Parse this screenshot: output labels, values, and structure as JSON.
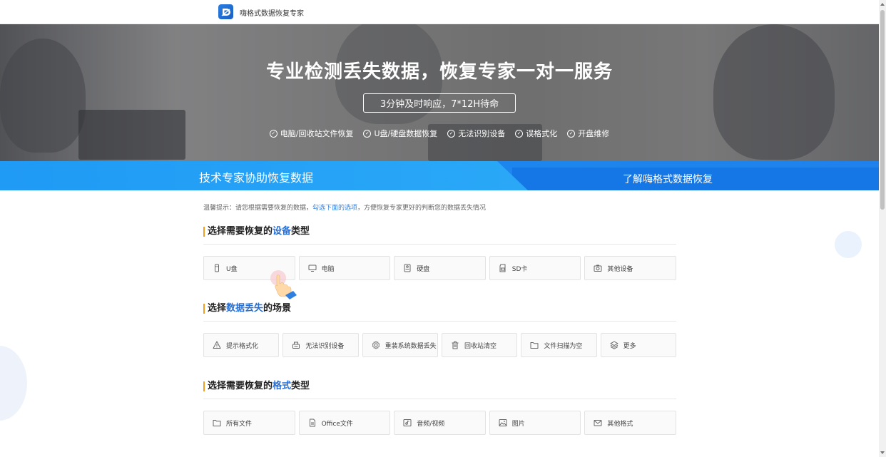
{
  "header": {
    "brand": "嗨格式数据恢复专家"
  },
  "hero": {
    "title": "专业检测丢失数据，恢复专家一对一服务",
    "subtitle": "3分钟及时响应，7*12H待命",
    "features": [
      "电脑/回收站文件恢复",
      "U盘/硬盘数据恢复",
      "无法识别设备",
      "误格式化",
      "开盘维修"
    ]
  },
  "banner": {
    "left": "技术专家协助恢复数据",
    "right": "了解嗨格式数据恢复"
  },
  "tip": {
    "prefix": "温馨提示：请您根据需要恢复的数据，",
    "highlight": "勾选下面的选项",
    "suffix": "，方便恢复专家更好的判断您的数据丢失情况"
  },
  "sections": [
    {
      "pre": "选择需要恢复的",
      "em": "设备",
      "post": "类型",
      "options": [
        {
          "label": "U盘",
          "icon": "usb-icon"
        },
        {
          "label": "电脑",
          "icon": "monitor-icon"
        },
        {
          "label": "硬盘",
          "icon": "harddisk-icon"
        },
        {
          "label": "SD卡",
          "icon": "sdcard-icon"
        },
        {
          "label": "其他设备",
          "icon": "camera-icon"
        }
      ]
    },
    {
      "pre": "选择",
      "em": "数据丢失",
      "post": "的场景",
      "options": [
        {
          "label": "提示格式化",
          "icon": "warning-icon"
        },
        {
          "label": "无法识别设备",
          "icon": "device-icon"
        },
        {
          "label": "重装系统数据丢失",
          "icon": "settings-icon"
        },
        {
          "label": "回收站清空",
          "icon": "trash-icon"
        },
        {
          "label": "文件扫描为空",
          "icon": "folder-icon"
        },
        {
          "label": "更多",
          "icon": "layers-icon"
        }
      ]
    },
    {
      "pre": "选择需要恢复的",
      "em": "格式",
      "post": "类型",
      "options": [
        {
          "label": "所有文件",
          "icon": "folder-icon"
        },
        {
          "label": "Office文件",
          "icon": "document-icon"
        },
        {
          "label": "音频/视频",
          "icon": "media-icon"
        },
        {
          "label": "图片",
          "icon": "image-icon"
        },
        {
          "label": "其他格式",
          "icon": "mail-icon"
        }
      ]
    }
  ],
  "colors": {
    "primary": "#1f86ee",
    "accent": "#f0a020",
    "highlight": "#2670d8"
  }
}
